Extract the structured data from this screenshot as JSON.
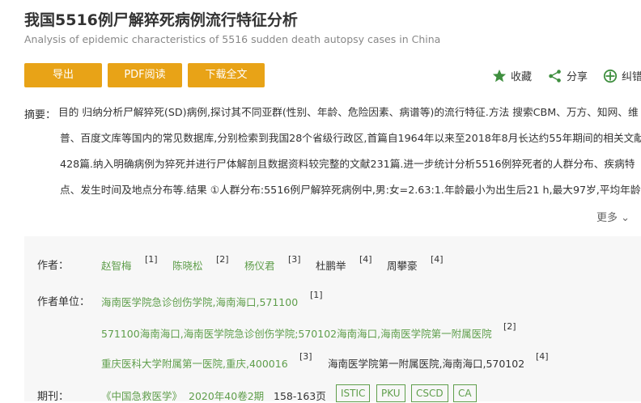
{
  "header": {
    "title": "我国5516例尸解猝死病例流行特征分析",
    "subtitle": "Analysis of epidemic characteristics of 5516 sudden death autopsy cases in China"
  },
  "toolbar": {
    "export_label": "导出",
    "pdf_label": "PDF阅读",
    "download_label": "下载全文",
    "favorite_label": "收藏",
    "share_label": "分享",
    "correct_label": "纠错"
  },
  "abstract": {
    "label": "摘要：",
    "lines": [
      "目的  归纳分析尸解猝死(SD)病例,探讨其不同亚群(性别、年龄、危险因素、病谱等)的流行特征.方法  搜索CBM、万方、知网、维",
      "普、百度文库等国内的常见数据库,分别检索到我国28个省级行政区,首篇自1964年以来至2018年8月长达约55年期间的相关文献",
      "428篇.纳入明确病例为猝死并进行尸体解剖且数据资料较完整的文献231篇.进一步统计分析5516例猝死者的人群分布、疾病特",
      "点、发生时间及地点分布等.结果  ①人群分布:5516例尸解猝死病例中,男:女=2.63:1.年龄最小为出生后21 h,最大97岁,平均年龄"
    ],
    "more_label": "更多"
  },
  "meta": {
    "authors_label": "作者：",
    "authors": [
      {
        "name": "赵智梅",
        "ref": "[1]"
      },
      {
        "name": "陈晓松",
        "ref": "[2]"
      },
      {
        "name": "杨仪君",
        "ref": "[3]"
      },
      {
        "name": "杜鹏举",
        "ref": "[4]"
      },
      {
        "name": "周攀豪",
        "ref": "[4]"
      }
    ],
    "units_label": "作者单位：",
    "units": [
      {
        "text": "海南医学院急诊创伤学院,海南海口,571100",
        "ref": "[1]"
      },
      {
        "text": "571100海南海口,海南医学院急诊创伤学院;570102海南海口,海南医学院第一附属医院",
        "ref": "[2]"
      },
      {
        "text": "重庆医科大学附属第一医院,重庆,400016",
        "ref": "[3]"
      },
      {
        "text": "海南医学院第一附属医院,海南海口,570102",
        "ref": "[4]"
      }
    ],
    "journal_label": "期刊：",
    "journal": "《中国急救医学》",
    "issue": "2020年40卷2期",
    "pages": "158-163页",
    "tags": [
      "ISTIC",
      "PKU",
      "CSCD",
      "CA"
    ]
  },
  "colors": {
    "accent": "#e8a317",
    "link": "#5f9e4b"
  }
}
